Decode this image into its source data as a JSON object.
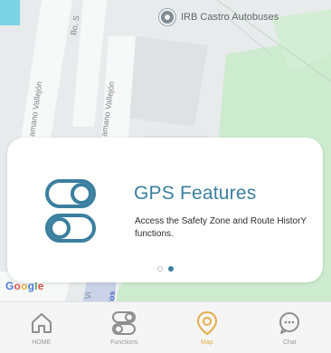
{
  "map": {
    "poi_label": "IRB Castro Autobuses",
    "streets": [
      "Bo. S",
      "amano Vallejón",
      "amano Vallejón"
    ],
    "bottom_street_fragments": [
      "Vi",
      "los"
    ],
    "attribution": "Google",
    "poi_icon": "map-pin-icon"
  },
  "card": {
    "title": "GPS Features",
    "description": "Access the Safety Zone and Route HistorY functions.",
    "icon": "toggle-switches-icon",
    "page_count": 2,
    "active_page": 2
  },
  "tabbar": {
    "items": [
      {
        "label": "HOME",
        "icon": "home-icon",
        "active": false
      },
      {
        "label": "Functions",
        "icon": "functions-icon",
        "active": false
      },
      {
        "label": "Map",
        "icon": "map-pin-icon",
        "active": true
      },
      {
        "label": "Chat",
        "icon": "chat-icon",
        "active": false
      }
    ]
  },
  "colors": {
    "accent": "#3b7f9f",
    "active_tab": "#e3ad4b",
    "inactive_tab": "#9a9a9a",
    "park": "#c8e8c9"
  }
}
